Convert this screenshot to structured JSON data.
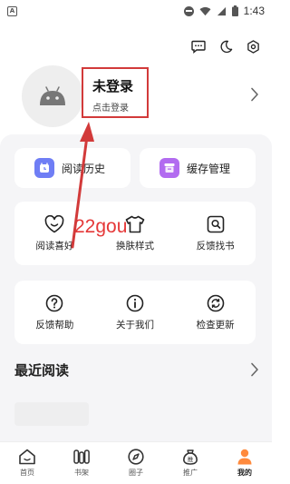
{
  "status_bar": {
    "time": "1:43",
    "left_badge": "A"
  },
  "profile": {
    "title": "未登录",
    "subtitle": "点击登录"
  },
  "quick_cards": [
    {
      "label": "阅读历史"
    },
    {
      "label": "缓存管理"
    }
  ],
  "grid_row1": [
    {
      "label": "阅读喜好",
      "icon": "smile-heart-icon"
    },
    {
      "label": "换肤样式",
      "icon": "shirt-icon"
    },
    {
      "label": "反馈找书",
      "icon": "search-book-icon"
    }
  ],
  "grid_row2": [
    {
      "label": "反馈帮助",
      "icon": "question-icon"
    },
    {
      "label": "关于我们",
      "icon": "info-icon"
    },
    {
      "label": "检查更新",
      "icon": "refresh-icon"
    }
  ],
  "recent": {
    "title": "最近阅读"
  },
  "watermark": "22gou",
  "bottom_nav": [
    {
      "label": "首页"
    },
    {
      "label": "书架"
    },
    {
      "label": "圈子"
    },
    {
      "label": "推广",
      "badge": "推"
    },
    {
      "label": "我的"
    }
  ],
  "colors": {
    "accent": "#ff8a3d",
    "annotation": "#d23a3a",
    "history_icon": "#6f7ef5",
    "cache_icon": "#b26bf0"
  }
}
